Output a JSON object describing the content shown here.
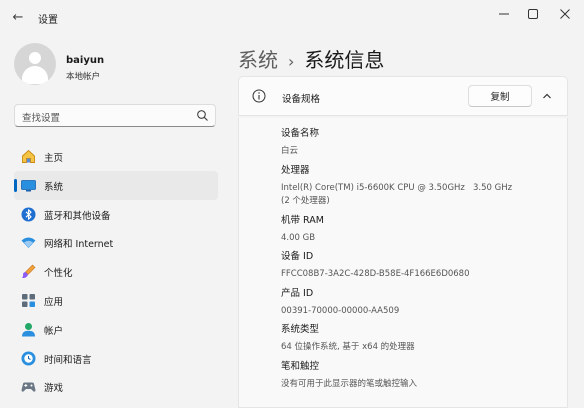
{
  "window": {
    "title": "设置",
    "back_glyph": "←",
    "min_glyph": "—",
    "max_glyph": "☐",
    "close_glyph": "✕"
  },
  "user": {
    "name": "baiyun",
    "account": "本地帐户"
  },
  "search": {
    "placeholder": "查找设置",
    "icon": "search-icon"
  },
  "sidebar": {
    "accent": "#0067c0",
    "items": [
      {
        "label": "主页",
        "icon": "home-icon"
      },
      {
        "label": "系统",
        "icon": "system-icon",
        "active": true
      },
      {
        "label": "蓝牙和其他设备",
        "icon": "bluetooth-icon"
      },
      {
        "label": "网络和 Internet",
        "icon": "network-icon"
      },
      {
        "label": "个性化",
        "icon": "personalization-icon"
      },
      {
        "label": "应用",
        "icon": "apps-icon"
      },
      {
        "label": "帐户",
        "icon": "account-icon"
      },
      {
        "label": "时间和语言",
        "icon": "time-language-icon"
      },
      {
        "label": "游戏",
        "icon": "gaming-icon"
      }
    ]
  },
  "breadcrumb": {
    "parent": "系统",
    "separator": "›",
    "current": "系统信息"
  },
  "device_specs": {
    "title": "设备规格",
    "copy_label": "复制",
    "items": [
      {
        "label": "设备名称",
        "value": "白云"
      },
      {
        "label": "处理器",
        "value": "Intel(R) Core(TM) i5-6600K CPU @ 3.50GHz   3.50 GHz\n(2 个处理器)"
      },
      {
        "label": "机带 RAM",
        "value": "4.00 GB"
      },
      {
        "label": "设备 ID",
        "value": "FFCC08B7-3A2C-428D-B58E-4F166E6D0680"
      },
      {
        "label": "产品 ID",
        "value": "00391-70000-00000-AA509"
      },
      {
        "label": "系统类型",
        "value": "64 位操作系统, 基于 x64 的处理器"
      },
      {
        "label": "笔和触控",
        "value": "没有可用于此显示器的笔或触控输入"
      }
    ]
  }
}
